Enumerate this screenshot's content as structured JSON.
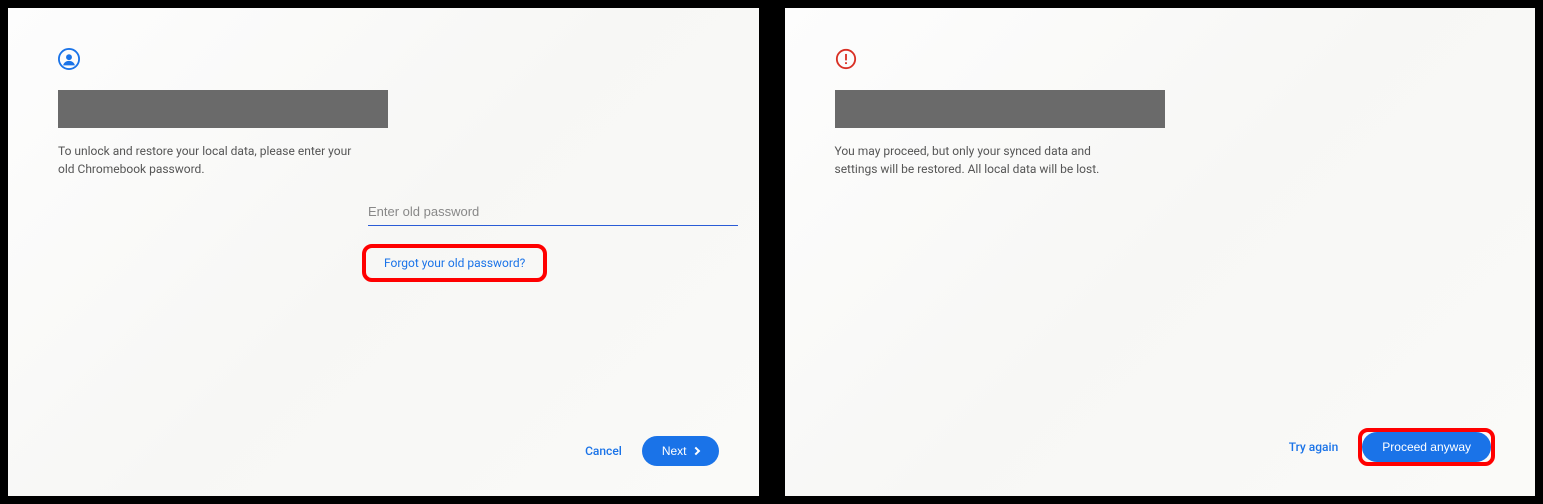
{
  "left": {
    "body_text": "To unlock and restore your local data, please enter your old Chromebook password.",
    "input_placeholder": "Enter old password",
    "forgot_link": "Forgot your old password?",
    "cancel_label": "Cancel",
    "next_label": "Next"
  },
  "right": {
    "body_text": "You may proceed, but only your synced data and settings will be restored. All local data will be lost.",
    "try_again_label": "Try again",
    "proceed_label": "Proceed anyway"
  }
}
